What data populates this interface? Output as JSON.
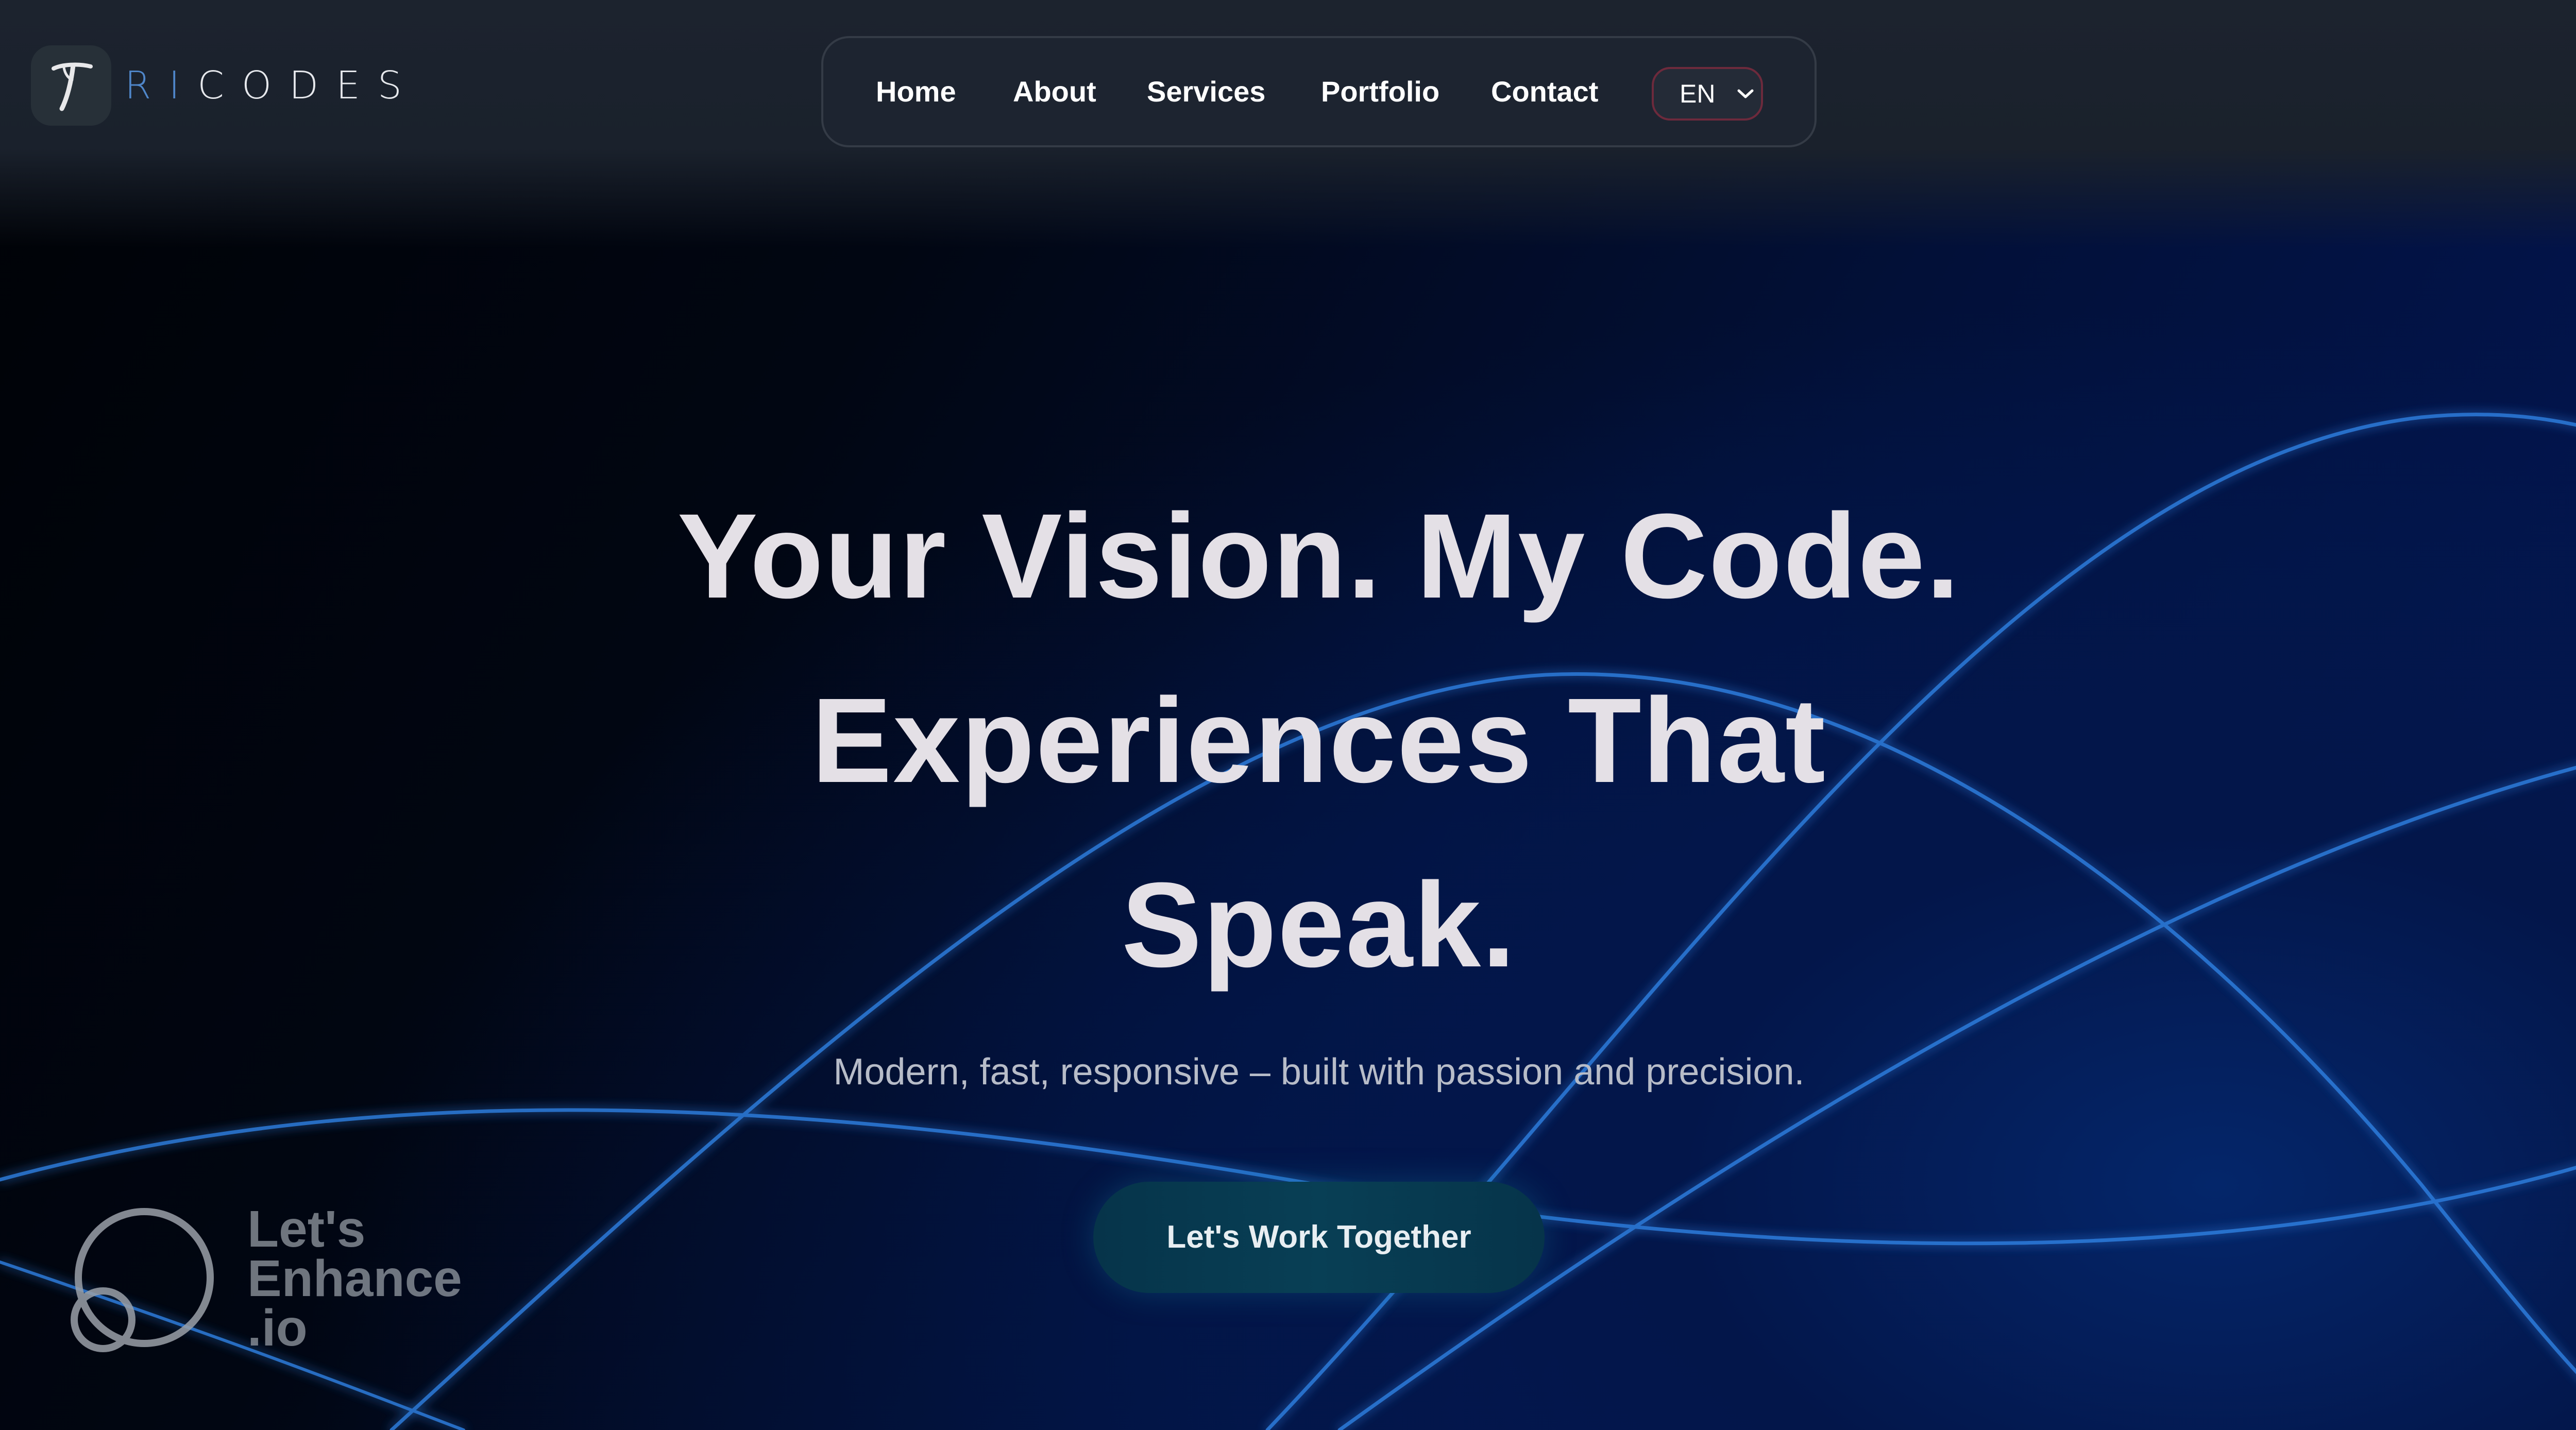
{
  "brand": {
    "logo_letter": "T",
    "name_accent": "RI",
    "name_rest": "CODES"
  },
  "nav": {
    "items": [
      {
        "label": "Home"
      },
      {
        "label": "About"
      },
      {
        "label": "Services"
      },
      {
        "label": "Portfolio"
      },
      {
        "label": "Contact"
      }
    ],
    "language": {
      "selected": "EN",
      "icon": "chevron-down-icon"
    }
  },
  "hero": {
    "headline_line1": "Your Vision. My Code.",
    "headline_line2": "Experiences That",
    "headline_line3": "Speak.",
    "subtitle": "Modern, fast, responsive – built with passion and precision.",
    "cta_label": "Let's Work Together"
  },
  "watermark": {
    "line1": "Let's",
    "line2": "Enhance",
    "line3": ".io"
  },
  "colors": {
    "background_dark": "#020814",
    "background_blue": "#03175a",
    "wave_line": "#2f7fe0",
    "nav_bg": "#1d2430",
    "cta_bg": "#083f55",
    "logo_accent": "#4f86c9",
    "headline": "#e4e0e6"
  }
}
